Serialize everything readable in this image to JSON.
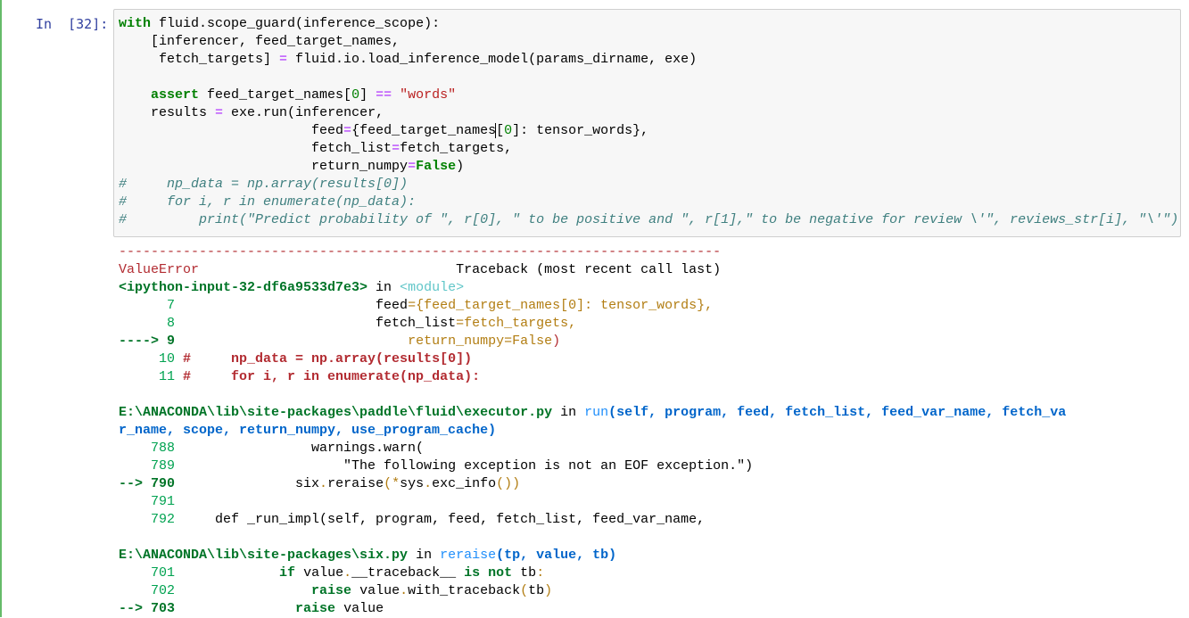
{
  "prompt": "In  [32]:",
  "code_lines": [
    [
      {
        "t": "with",
        "c": "kw"
      },
      {
        "t": " fluid.scope_guard(inference_scope):"
      }
    ],
    [
      {
        "t": "    [inferencer, feed_target_names,"
      }
    ],
    [
      {
        "t": "     fetch_targets] "
      },
      {
        "t": "=",
        "c": "op"
      },
      {
        "t": " fluid.io.load_inference_model(params_dirname, exe)"
      }
    ],
    [
      {
        "t": ""
      }
    ],
    [
      {
        "t": "    "
      },
      {
        "t": "assert",
        "c": "kw"
      },
      {
        "t": " feed_target_names["
      },
      {
        "t": "0",
        "c": "num"
      },
      {
        "t": "] "
      },
      {
        "t": "==",
        "c": "op"
      },
      {
        "t": " "
      },
      {
        "t": "\"words\"",
        "c": "str"
      }
    ],
    [
      {
        "t": "    results "
      },
      {
        "t": "=",
        "c": "op"
      },
      {
        "t": " exe.run(inferencer,"
      }
    ],
    [
      {
        "t": "                        feed"
      },
      {
        "t": "=",
        "c": "op"
      },
      {
        "t": "{feed_target_names"
      },
      {
        "t": "[",
        "c": "cursor"
      },
      {
        "t": "0",
        "c": "num"
      },
      {
        "t": "]: tensor_words},"
      }
    ],
    [
      {
        "t": "                        fetch_list"
      },
      {
        "t": "=",
        "c": "op"
      },
      {
        "t": "fetch_targets,"
      }
    ],
    [
      {
        "t": "                        return_numpy"
      },
      {
        "t": "=",
        "c": "op"
      },
      {
        "t": "False",
        "c": "kw"
      },
      {
        "t": ")"
      }
    ],
    [
      {
        "t": "#     np_data = np.array(results[0])",
        "c": "cm"
      }
    ],
    [
      {
        "t": "#     for i, r in enumerate(np_data):",
        "c": "cm"
      }
    ],
    [
      {
        "t": "#         print(\"Predict probability of \", r[0], \" to be positive and \", r[1],\" to be negative for review \\'\", reviews_str[i], \"\\'\")",
        "c": "cm"
      }
    ]
  ],
  "output_lines": [
    [
      {
        "t": "---------------------------------------------------------------------------",
        "c": "red"
      }
    ],
    [
      {
        "t": "ValueError",
        "c": "red"
      },
      {
        "t": "                                Traceback (most recent call last)"
      }
    ],
    [
      {
        "t": "<ipython-input-32-df6a9533d7e3>",
        "c": "bgrn"
      },
      {
        "t": " in "
      },
      {
        "t": "<module>",
        "c": "cyan"
      }
    ],
    [
      {
        "t": "      7",
        "c": "grn"
      },
      {
        "t": "                         feed"
      },
      {
        "t": "={feed_target_names[0]: tensor_words},",
        "c": "yel"
      }
    ],
    [
      {
        "t": "      8",
        "c": "grn"
      },
      {
        "t": "                         fetch_list"
      },
      {
        "t": "=fetch_targets,",
        "c": "yel"
      }
    ],
    [
      {
        "t": "----> 9",
        "c": "bgrn"
      },
      {
        "t": "                             "
      },
      {
        "t": "return_numpy=False",
        "c": "yel"
      },
      {
        "t": ")",
        "c": "red"
      }
    ],
    [
      {
        "t": "     10",
        "c": "grn"
      },
      {
        "t": " #     np_data = np.array(results[0])",
        "c": "bred"
      }
    ],
    [
      {
        "t": "     11",
        "c": "grn"
      },
      {
        "t": " #     for i, r in enumerate(np_data):",
        "c": "bred"
      }
    ],
    [
      {
        "t": ""
      }
    ],
    [
      {
        "t": "E:\\ANACONDA\\lib\\site-packages\\paddle\\fluid\\executor.py",
        "c": "bgrn"
      },
      {
        "t": " in "
      },
      {
        "t": "run",
        "c": "blue"
      },
      {
        "t": "(self, program, feed, fetch_list, feed_var_name, fetch_va",
        "c": "bblue"
      }
    ],
    [
      {
        "t": "r_name, scope, return_numpy, use_program_cache)",
        "c": "bblue"
      }
    ],
    [
      {
        "t": "    788",
        "c": "grn"
      },
      {
        "t": "                 warnings.warn("
      }
    ],
    [
      {
        "t": "    789",
        "c": "grn"
      },
      {
        "t": "                     \"The following exception is not an EOF exception.\")"
      }
    ],
    [
      {
        "t": "--> 790",
        "c": "bgrn"
      },
      {
        "t": "               six"
      },
      {
        "t": ".",
        "c": "yel"
      },
      {
        "t": "reraise"
      },
      {
        "t": "(*",
        "c": "yel"
      },
      {
        "t": "sys"
      },
      {
        "t": ".",
        "c": "yel"
      },
      {
        "t": "exc_info"
      },
      {
        "t": "())",
        "c": "yel"
      }
    ],
    [
      {
        "t": "    791",
        "c": "grn"
      }
    ],
    [
      {
        "t": "    792",
        "c": "grn"
      },
      {
        "t": "     def _run_impl(self, program, feed, fetch_list, feed_var_name,"
      }
    ],
    [
      {
        "t": ""
      }
    ],
    [
      {
        "t": "E:\\ANACONDA\\lib\\site-packages\\six.py",
        "c": "bgrn"
      },
      {
        "t": " in "
      },
      {
        "t": "reraise",
        "c": "blue"
      },
      {
        "t": "(tp, value, tb)",
        "c": "bblue"
      }
    ],
    [
      {
        "t": "    701",
        "c": "grn"
      },
      {
        "t": "             "
      },
      {
        "t": "if",
        "c": "bgrn"
      },
      {
        "t": " value"
      },
      {
        "t": ".",
        "c": "yel"
      },
      {
        "t": "__traceback__ "
      },
      {
        "t": "is",
        "c": "bgrn"
      },
      {
        "t": " "
      },
      {
        "t": "not",
        "c": "bgrn"
      },
      {
        "t": " tb"
      },
      {
        "t": ":",
        "c": "yel"
      }
    ],
    [
      {
        "t": "    702",
        "c": "grn"
      },
      {
        "t": "                 "
      },
      {
        "t": "raise",
        "c": "bgrn"
      },
      {
        "t": " value"
      },
      {
        "t": ".",
        "c": "yel"
      },
      {
        "t": "with_traceback"
      },
      {
        "t": "(",
        "c": "yel"
      },
      {
        "t": "tb"
      },
      {
        "t": ")",
        "c": "yel"
      }
    ],
    [
      {
        "t": "--> 703",
        "c": "bgrn"
      },
      {
        "t": "               "
      },
      {
        "t": "raise",
        "c": "bgrn"
      },
      {
        "t": " value"
      }
    ]
  ]
}
